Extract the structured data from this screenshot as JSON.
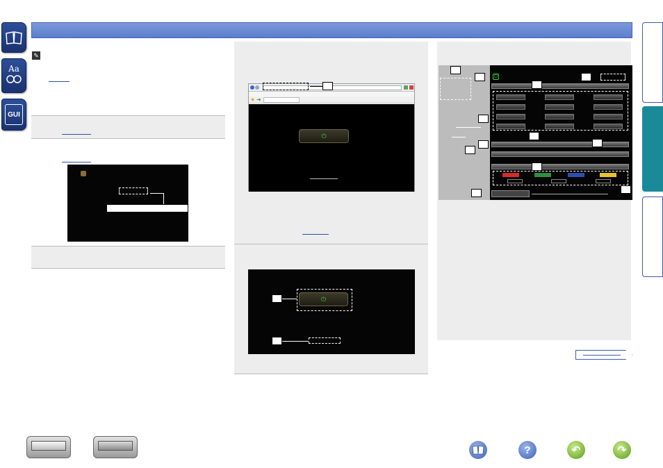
{
  "side_tabs": [
    {
      "name": "book-tab",
      "label": ""
    },
    {
      "name": "glossary-tab",
      "label": "Aa"
    },
    {
      "name": "gui-tab",
      "label": "GUI"
    }
  ],
  "browser": {
    "callout": "",
    "icons": [
      "back-icon",
      "forward-icon",
      "favorites-star-icon",
      "add-favorite-icon"
    ]
  },
  "colors": {
    "header": "#6a8bd4",
    "link": "#2c50b0",
    "power": "#3fd13a",
    "color_buttons": [
      "#d62b2b",
      "#2e8f3e",
      "#2e4fb0",
      "#e6c52a"
    ]
  },
  "icons": {
    "pencil": "pencil-icon",
    "book": "book-icon",
    "help": "question-icon",
    "back": "back-icon",
    "forward": "forward-icon"
  }
}
